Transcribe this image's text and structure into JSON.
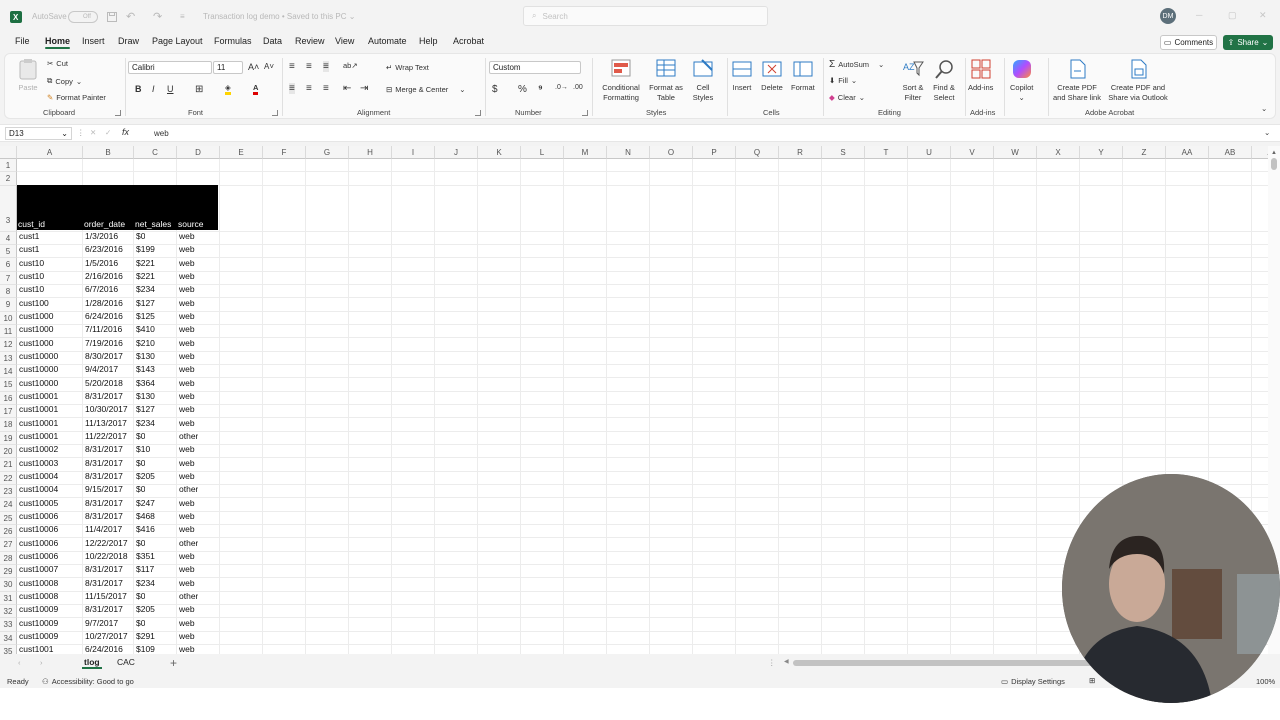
{
  "title_bar": {
    "autosave_label": "AutoSave",
    "autosave_state": "Off",
    "document_title": "Transaction log demo • Saved to this PC ⌄",
    "search_placeholder": "Search",
    "user_initials": "DM"
  },
  "menu": {
    "items": [
      "File",
      "Home",
      "Insert",
      "Draw",
      "Page Layout",
      "Formulas",
      "Data",
      "Review",
      "View",
      "Automate",
      "Help",
      "Acrobat"
    ],
    "active": "Home",
    "comments_label": "Comments",
    "share_label": "Share"
  },
  "ribbon": {
    "clipboard": {
      "paste": "Paste",
      "cut": "Cut",
      "copy": "Copy",
      "format_painter": "Format Painter",
      "label": "Clipboard"
    },
    "font": {
      "name": "Calibri",
      "size": "11",
      "label": "Font"
    },
    "alignment": {
      "wrap_text": "Wrap Text",
      "merge_center": "Merge & Center",
      "label": "Alignment"
    },
    "number": {
      "format": "Custom",
      "label": "Number"
    },
    "styles": {
      "conditional": "Conditional Formatting",
      "format_table": "Format as Table",
      "cell_styles": "Cell Styles",
      "label": "Styles"
    },
    "cells": {
      "insert": "Insert",
      "delete": "Delete",
      "format": "Format",
      "label": "Cells"
    },
    "editing": {
      "autosum": "AutoSum",
      "fill": "Fill",
      "clear": "Clear",
      "sort_filter": "Sort & Filter",
      "find_select": "Find & Select",
      "label": "Editing"
    },
    "addins": {
      "button": "Add-ins",
      "label": "Add-ins"
    },
    "copilot": {
      "button": "Copilot"
    },
    "acrobat": {
      "create_share": "Create PDF and Share link",
      "create_outlook": "Create PDF and Share via Outlook",
      "label": "Adobe Acrobat"
    }
  },
  "formula_bar": {
    "name_box": "D13",
    "fx": "fx",
    "value": "web"
  },
  "columns": [
    "A",
    "B",
    "C",
    "D",
    "E",
    "F",
    "G",
    "H",
    "I",
    "J",
    "K",
    "L",
    "M",
    "N",
    "O",
    "P",
    "Q",
    "R",
    "S",
    "T",
    "U",
    "V",
    "W",
    "X",
    "Y",
    "Z",
    "AA",
    "AB",
    "AC"
  ],
  "rows": [
    "1",
    "2",
    "3",
    "4",
    "5",
    "6",
    "7",
    "8",
    "9",
    "10",
    "11",
    "12",
    "13",
    "14",
    "15",
    "16",
    "17",
    "18",
    "19",
    "20",
    "21",
    "22",
    "23",
    "24",
    "25",
    "26",
    "27",
    "28",
    "29",
    "30",
    "31",
    "32",
    "33",
    "34",
    "35"
  ],
  "table_headers": [
    "cust_id",
    "order_date",
    "net_sales",
    "source"
  ],
  "table_rows": [
    [
      "cust1",
      "1/3/2016",
      "$0",
      "web"
    ],
    [
      "cust1",
      "6/23/2016",
      "$199",
      "web"
    ],
    [
      "cust10",
      "1/5/2016",
      "$221",
      "web"
    ],
    [
      "cust10",
      "2/16/2016",
      "$221",
      "web"
    ],
    [
      "cust10",
      "6/7/2016",
      "$234",
      "web"
    ],
    [
      "cust100",
      "1/28/2016",
      "$127",
      "web"
    ],
    [
      "cust1000",
      "6/24/2016",
      "$125",
      "web"
    ],
    [
      "cust1000",
      "7/11/2016",
      "$410",
      "web"
    ],
    [
      "cust1000",
      "7/19/2016",
      "$210",
      "web"
    ],
    [
      "cust10000",
      "8/30/2017",
      "$130",
      "web"
    ],
    [
      "cust10000",
      "9/4/2017",
      "$143",
      "web"
    ],
    [
      "cust10000",
      "5/20/2018",
      "$364",
      "web"
    ],
    [
      "cust10001",
      "8/31/2017",
      "$130",
      "web"
    ],
    [
      "cust10001",
      "10/30/2017",
      "$127",
      "web"
    ],
    [
      "cust10001",
      "11/13/2017",
      "$234",
      "web"
    ],
    [
      "cust10001",
      "11/22/2017",
      "$0",
      "other"
    ],
    [
      "cust10002",
      "8/31/2017",
      "$10",
      "web"
    ],
    [
      "cust10003",
      "8/31/2017",
      "$0",
      "web"
    ],
    [
      "cust10004",
      "8/31/2017",
      "$205",
      "web"
    ],
    [
      "cust10004",
      "9/15/2017",
      "$0",
      "other"
    ],
    [
      "cust10005",
      "8/31/2017",
      "$247",
      "web"
    ],
    [
      "cust10006",
      "8/31/2017",
      "$468",
      "web"
    ],
    [
      "cust10006",
      "11/4/2017",
      "$416",
      "web"
    ],
    [
      "cust10006",
      "12/22/2017",
      "$0",
      "other"
    ],
    [
      "cust10006",
      "10/22/2018",
      "$351",
      "web"
    ],
    [
      "cust10007",
      "8/31/2017",
      "$117",
      "web"
    ],
    [
      "cust10008",
      "8/31/2017",
      "$234",
      "web"
    ],
    [
      "cust10008",
      "11/15/2017",
      "$0",
      "other"
    ],
    [
      "cust10009",
      "8/31/2017",
      "$205",
      "web"
    ],
    [
      "cust10009",
      "9/7/2017",
      "$0",
      "web"
    ],
    [
      "cust10009",
      "10/27/2017",
      "$291",
      "web"
    ],
    [
      "cust1001",
      "6/24/2016",
      "$109",
      "web"
    ]
  ],
  "sheets": [
    "tlog",
    "CAC"
  ],
  "active_sheet": "tlog",
  "status": {
    "ready": "Ready",
    "accessibility": "Accessibility: Good to go",
    "display_settings": "Display Settings",
    "zoom": "100%"
  },
  "colors": {
    "accent": "#217346",
    "header_fill": "#000000"
  }
}
